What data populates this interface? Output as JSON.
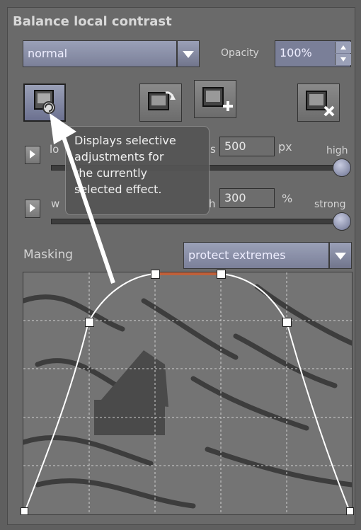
{
  "panel": {
    "title": "Balance local contrast"
  },
  "blend": {
    "mode_value": "normal",
    "opacity_label": "Opacity",
    "opacity_value": "100%"
  },
  "toolbar": {
    "icons": [
      "selective-adjustments-icon",
      "refresh-icon",
      "add-layer-icon",
      "delete-icon"
    ]
  },
  "params": {
    "size": {
      "label_visible": "lo",
      "label_tail": "s",
      "value": "500",
      "unit": "px",
      "end_label": "high"
    },
    "weight": {
      "label_visible": "w",
      "label_tail": "h",
      "value": "300",
      "unit": "%",
      "end_label": "strong"
    }
  },
  "tooltip": {
    "lines": [
      "Displays selective",
      "adjustments for",
      "the currently",
      "selected effect."
    ]
  },
  "masking": {
    "label": "Masking",
    "value": "protect extremes"
  },
  "colors": {
    "accent": "#8f95b0",
    "curve_highlight": "#c0603a"
  }
}
